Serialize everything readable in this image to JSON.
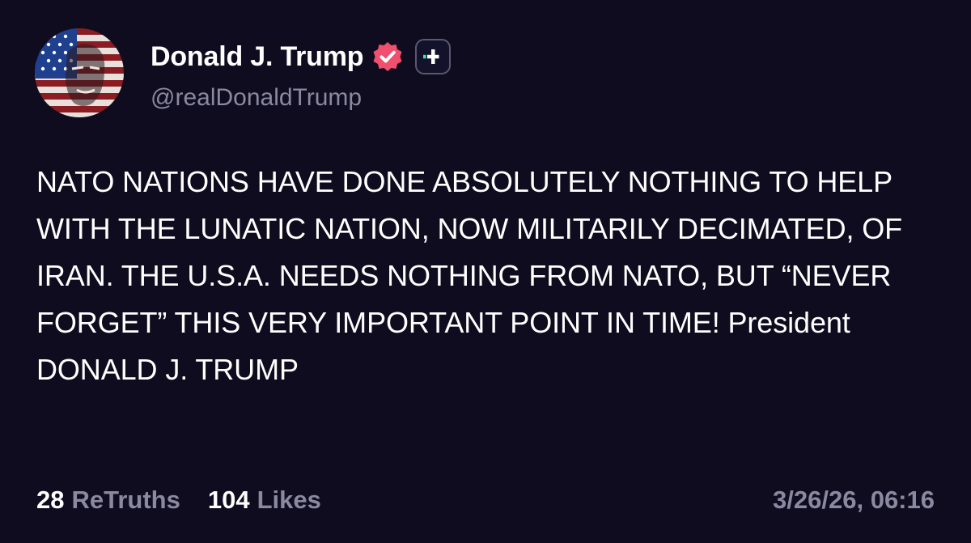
{
  "colors": {
    "background": "#0e0c1e",
    "text_primary": "#ffffff",
    "text_secondary": "#8b89a0",
    "verified_badge": "#f04f6d",
    "plus_badge_accent": "#3ee0b5"
  },
  "author": {
    "display_name": "Donald J. Trump",
    "handle": "@realDonaldTrump",
    "avatar_icon": "avatar-flag-portrait",
    "verified_icon": "verified-badge-icon",
    "plus_icon": "truth-plus-icon"
  },
  "post": {
    "text": "NATO NATIONS HAVE DONE ABSOLUTELY NOTHING TO HELP WITH THE LUNATIC NATION, NOW MILITARILY DECIMATED, OF IRAN. THE U.S.A. NEEDS NOTHING FROM NATO, BUT “NEVER FORGET” THIS VERY IMPORTANT POINT IN TIME! President DONALD J. TRUMP"
  },
  "stats": {
    "retruths_count": "28",
    "retruths_label": "ReTruths",
    "likes_count": "104",
    "likes_label": "Likes"
  },
  "timestamp": "3/26/26, 06:16"
}
